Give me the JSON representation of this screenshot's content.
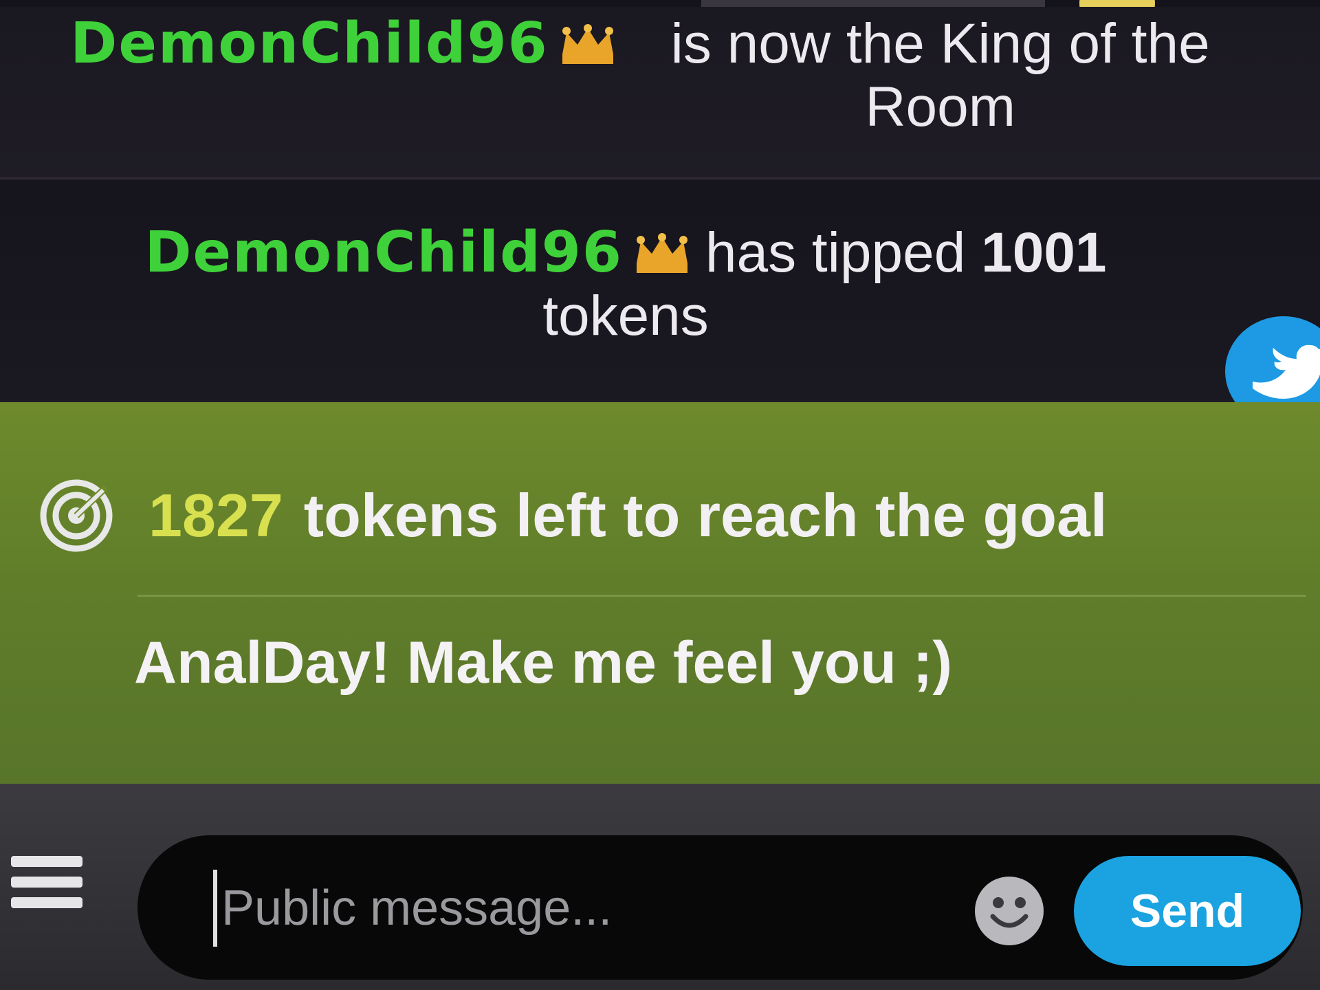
{
  "chat": {
    "messages": [
      {
        "username": "DemonChild96",
        "text": "is now the King of the Room"
      },
      {
        "username": "DemonChild96",
        "text_before": "has tipped",
        "amount": "1001",
        "text_after": "tokens"
      }
    ]
  },
  "goal": {
    "tokens_left": "1827",
    "text": "tokens left to reach the goal",
    "subject": "AnalDay! Make me feel you ;)"
  },
  "input": {
    "placeholder": "Public message...",
    "value": "",
    "send_label": "Send"
  },
  "icons": {
    "crown": "crown-icon",
    "twitter": "twitter-icon",
    "goal": "target-icon",
    "menu": "hamburger-menu-icon",
    "emoji": "smiley-icon"
  },
  "colors": {
    "username": "#3fd13a",
    "crown": "#e8a52a",
    "goal_panel": "#6e8a2c",
    "tokens_left": "#d8e050",
    "send_button": "#1aa3e0",
    "twitter": "#1d9ae3"
  }
}
